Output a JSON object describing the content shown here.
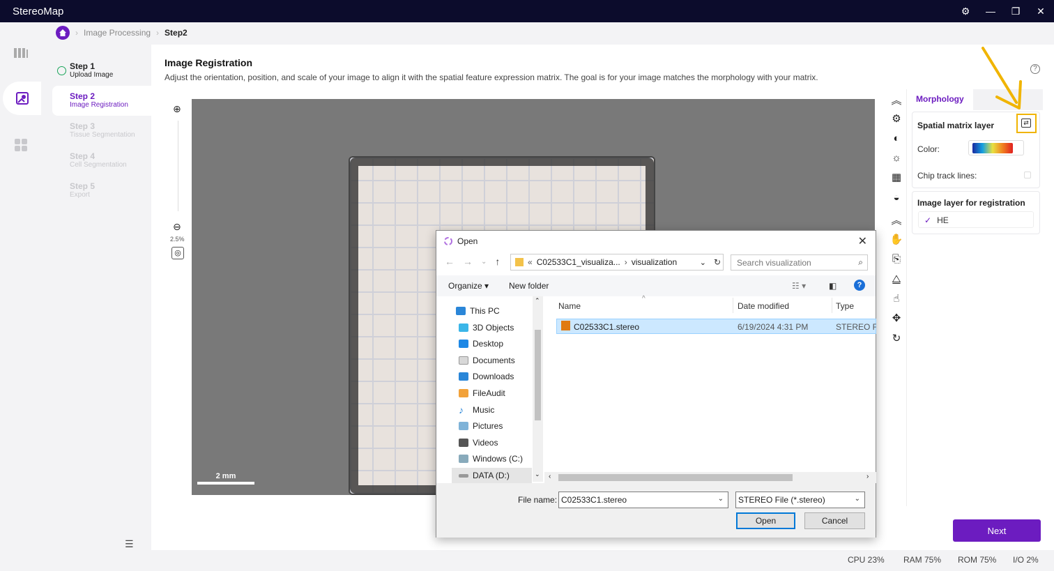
{
  "app": {
    "title": "StereoMap"
  },
  "breadcrumb": {
    "items": [
      "Image Processing",
      "Step2"
    ]
  },
  "steps": [
    {
      "title": "Step 1",
      "subtitle": "Upload Image",
      "state": "done"
    },
    {
      "title": "Step 2",
      "subtitle": "Image Registration",
      "state": "active"
    },
    {
      "title": "Step 3",
      "subtitle": "Tissue Segmentation",
      "state": "disabled"
    },
    {
      "title": "Step 4",
      "subtitle": "Cell Segmentation",
      "state": "disabled"
    },
    {
      "title": "Step 5",
      "subtitle": "Export",
      "state": "disabled"
    }
  ],
  "section": {
    "title": "Image Registration",
    "description": "Adjust the orientation, position, and scale of your image to align it with the spatial feature expression matrix. The goal is for your image matches the morphology with your matrix."
  },
  "zoom": {
    "level": "2.5%"
  },
  "canvas": {
    "scale_label": "2 mm"
  },
  "right_panel": {
    "tab": "Morphology",
    "spatial_header": "Spatial matrix layer",
    "color_label": "Color:",
    "chip_label": "Chip track lines:",
    "image_layer_header": "Image layer for registration",
    "image_layer_value": "HE"
  },
  "next_label": "Next",
  "status": {
    "cpu": "CPU  23%",
    "ram": "RAM  75%",
    "rom": "ROM  75%",
    "io": "I/O  2%"
  },
  "dialog": {
    "title": "Open",
    "path": [
      "C02533C1_visualiza...",
      "visualization"
    ],
    "search_placeholder": "Search visualization",
    "organize": "Organize",
    "new_folder": "New folder",
    "nav_items": [
      "This PC",
      "3D Objects",
      "Desktop",
      "Documents",
      "Downloads",
      "FileAudit",
      "Music",
      "Pictures",
      "Videos",
      "Windows (C:)",
      "DATA (D:)"
    ],
    "columns": [
      "Name",
      "Date modified",
      "Type"
    ],
    "file": {
      "name": "C02533C1.stereo",
      "date": "6/19/2024 4:31 PM",
      "type": "STEREO File"
    },
    "filename_label": "File name:",
    "filename_value": "C02533C1.stereo",
    "filetype_value": "STEREO File (*.stereo)",
    "open_label": "Open",
    "cancel_label": "Cancel"
  },
  "colors": {
    "accent": "#6c1cc0",
    "titlebar": "#0c0c2c",
    "highlight": "#f0b400"
  }
}
